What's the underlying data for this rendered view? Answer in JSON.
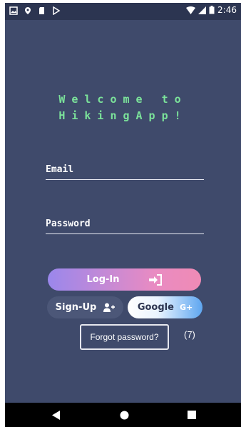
{
  "status_bar": {
    "time": "2:46",
    "icons": [
      "gallery-icon",
      "location-icon",
      "sd-card-icon",
      "play-store-icon",
      "wifi-icon",
      "signal-icon",
      "battery-icon"
    ]
  },
  "welcome": {
    "line1": "Welcome to",
    "line2": "HikingApp!"
  },
  "form": {
    "email_placeholder": "Email",
    "email_value": "",
    "password_placeholder": "Password",
    "password_value": ""
  },
  "buttons": {
    "login_label": "Log-In",
    "signup_label": "Sign-Up",
    "google_label": "Google",
    "google_suffix": "G+",
    "forgot_label": "Forgot password?"
  },
  "count_label": "(7)",
  "navigation": {
    "back": "back-icon",
    "home": "home-icon",
    "recent": "recent-apps-icon"
  },
  "colors": {
    "background": "#3f4a6b",
    "status_bar": "#2c3551",
    "welcome_text": "#7be29a",
    "login_gradient_start": "#9a87ec",
    "login_gradient_end": "#ef8bb5",
    "signup_bg": "#4c5778",
    "google_gradient_end": "#5ea6f0"
  }
}
